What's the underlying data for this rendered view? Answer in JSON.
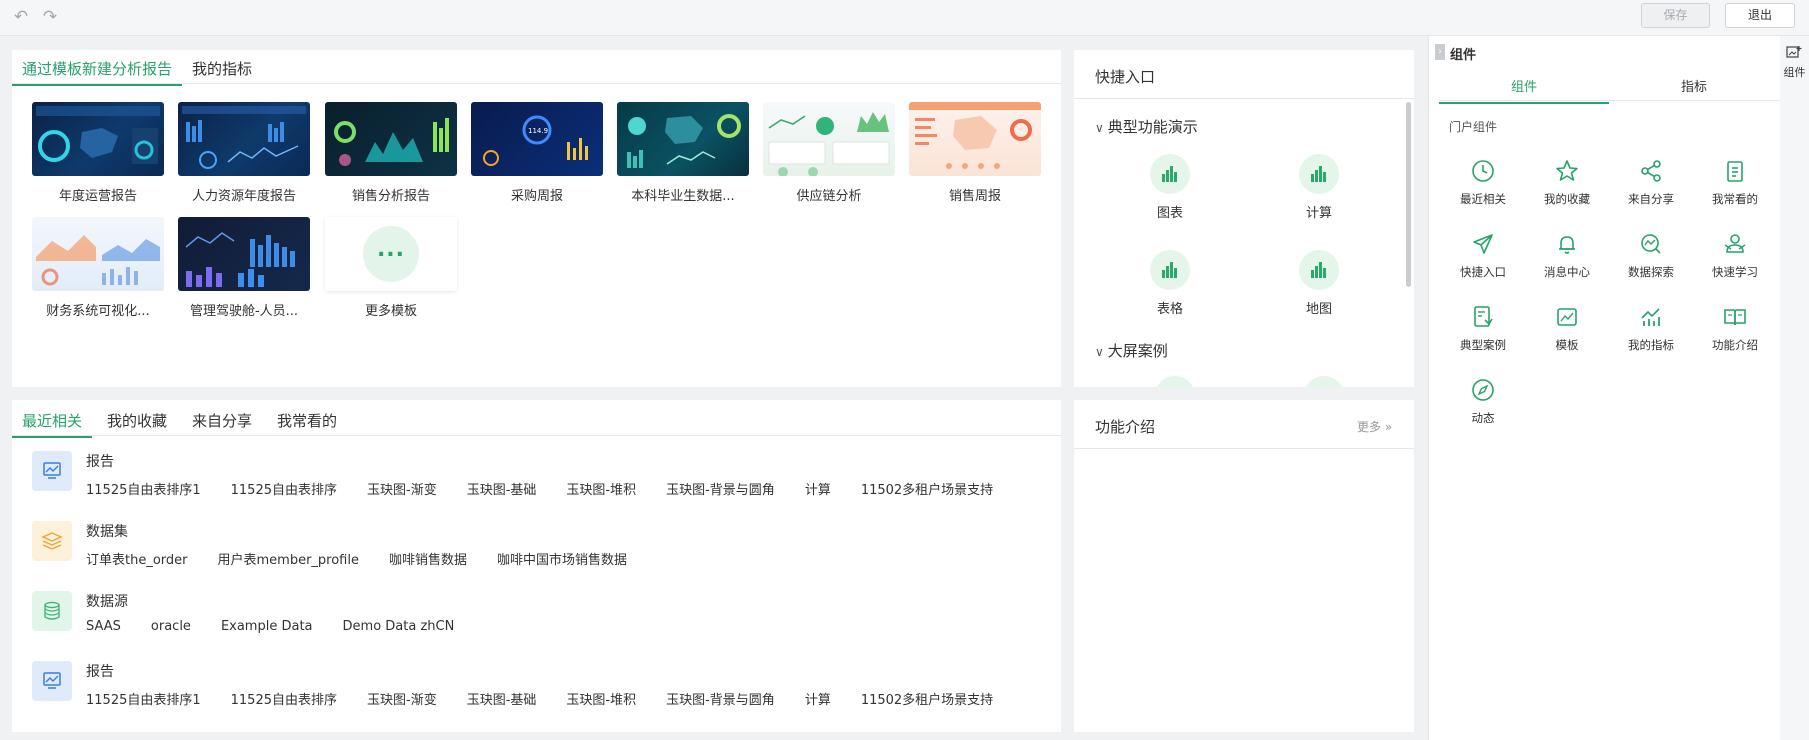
{
  "toolbar": {
    "save": "保存",
    "exit": "退出"
  },
  "templates_panel": {
    "tabs": [
      "通过模板新建分析报告",
      "我的指标"
    ],
    "items": [
      {
        "name": "年度运营报告"
      },
      {
        "name": "人力资源年度报告"
      },
      {
        "name": "销售分析报告"
      },
      {
        "name": "采购周报"
      },
      {
        "name": "本科毕业生数据..."
      },
      {
        "name": "供应链分析"
      },
      {
        "name": "销售周报"
      },
      {
        "name": "财务系统可视化..."
      },
      {
        "name": "管理驾驶舱-人员..."
      },
      {
        "name": "更多模板"
      }
    ],
    "more_icon": "..."
  },
  "quick_entry": {
    "title": "快捷入口",
    "sections": [
      {
        "title": "典型功能演示",
        "items": [
          "图表",
          "计算",
          "表格",
          "地图"
        ]
      },
      {
        "title": "大屏案例"
      }
    ]
  },
  "recent_panel": {
    "tabs": [
      "最近相关",
      "我的收藏",
      "来自分享",
      "我常看的"
    ],
    "groups": [
      {
        "title": "报告",
        "items": [
          "11525自由表排序1",
          "11525自由表排序",
          "玉玦图-渐变",
          "玉玦图-基础",
          "玉玦图-堆积",
          "玉玦图-背景与圆角",
          "计算",
          "11502多租户场景支持"
        ]
      },
      {
        "title": "数据集",
        "items": [
          "订单表the_order",
          "用户表member_profile",
          "咖啡销售数据",
          "咖啡中国市场销售数据"
        ]
      },
      {
        "title": "数据源",
        "items": [
          "SAAS",
          "oracle",
          "Example Data",
          "Demo Data zhCN"
        ]
      },
      {
        "title": "报告",
        "items": [
          "11525自由表排序1",
          "11525自由表排序",
          "玉玦图-渐变",
          "玉玦图-基础",
          "玉玦图-堆积",
          "玉玦图-背景与圆角",
          "计算",
          "11502多租户场景支持"
        ]
      }
    ]
  },
  "feature_panel": {
    "title": "功能介绍",
    "more": "更多"
  },
  "right_panel": {
    "title": "组件",
    "tabs": [
      "组件",
      "指标"
    ],
    "subtitle": "门户组件",
    "components": [
      "最近相关",
      "我的收藏",
      "来自分享",
      "我常看的",
      "快捷入口",
      "消息中心",
      "数据探索",
      "快速学习",
      "典型案例",
      "模板",
      "我的指标",
      "功能介绍",
      "动态"
    ]
  },
  "sidebar": {
    "label": "组件"
  },
  "colors": {
    "accent": "#27a36a",
    "report_icon_bg": "#dfeafb",
    "dataset_icon_bg": "#fdf1dc",
    "source_icon_bg": "#e2f5ea"
  }
}
